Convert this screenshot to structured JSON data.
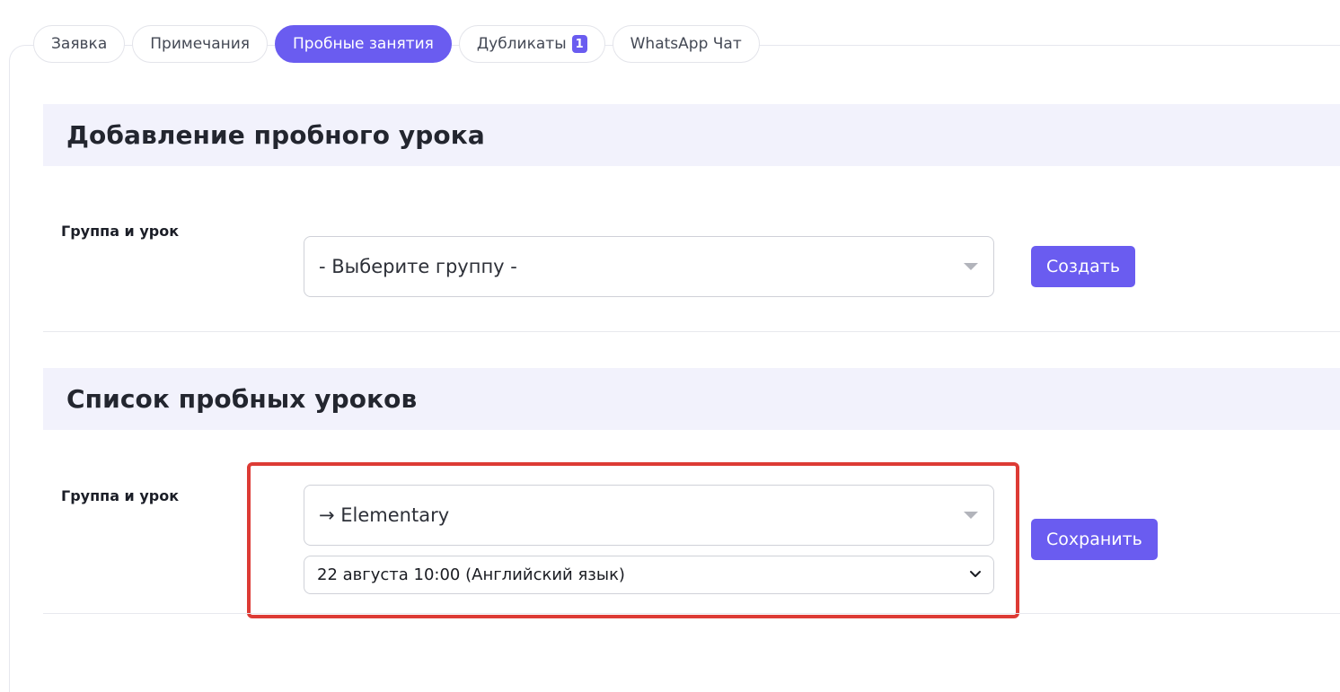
{
  "tabs": [
    {
      "label": "Заявка",
      "active": false
    },
    {
      "label": "Примечания",
      "active": false
    },
    {
      "label": "Пробные занятия",
      "active": true
    },
    {
      "label": "Дубликаты",
      "badge": "1",
      "active": false
    },
    {
      "label": "WhatsApp Чат",
      "active": false
    }
  ],
  "add_section": {
    "title": "Добавление пробного урока",
    "field_label": "Группа и урок",
    "group_select": {
      "value": "- Выберите группу -"
    },
    "create_button": "Создать"
  },
  "list_section": {
    "title": "Список пробных уроков",
    "field_label": "Группа и урок",
    "group_select": {
      "value": "→ Elementary"
    },
    "lesson_select": {
      "value": "22 августа 10:00 (Английский язык)"
    },
    "save_button": "Сохранить"
  },
  "colors": {
    "accent": "#6a5cf0",
    "section_header_bg": "#f2f2fc",
    "highlight_border": "#dd3b35"
  }
}
